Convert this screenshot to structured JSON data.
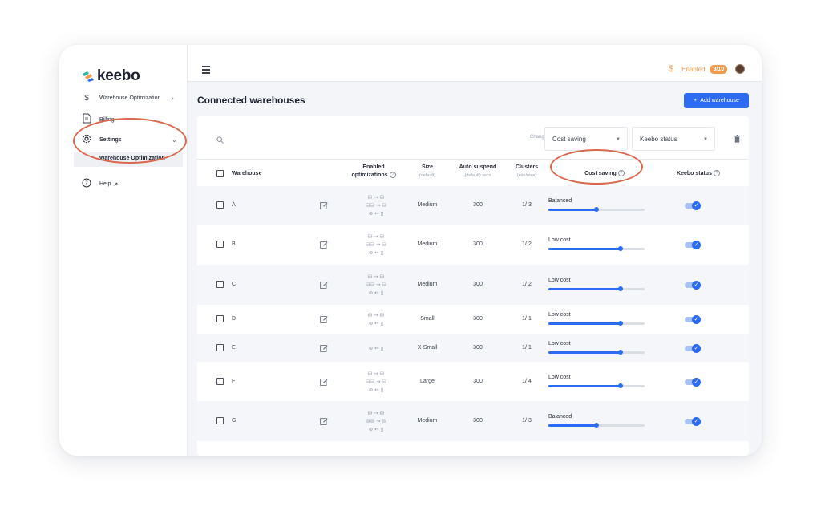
{
  "brand": {
    "name": "keebo"
  },
  "sidebar": {
    "items": [
      {
        "label": "Warehouse Optimization",
        "icon": "dollar-icon",
        "chevron": "›"
      },
      {
        "label": "Billing",
        "icon": "invoice-icon"
      },
      {
        "label": "Settings",
        "icon": "gear-icon",
        "chevron": "⌄"
      },
      {
        "label": "Warehouse Optimization",
        "sub": true
      },
      {
        "label": "Help",
        "icon": "help-icon"
      }
    ]
  },
  "topbar": {
    "enabled_label": "Enabled",
    "enabled_count": "9/10"
  },
  "page": {
    "title": "Connected warehouses",
    "add_button": "Add warehouse",
    "add_icon": "+"
  },
  "filters": {
    "change_label": "Change",
    "cost_saving": "Cost saving",
    "keebo_status": "Keebo status"
  },
  "table": {
    "headers": {
      "warehouse": "Warehouse",
      "enabled": "Enabled",
      "optimizations": "optimizations",
      "size": "Size",
      "size_sub": "(default)",
      "auto_suspend": "Auto suspend",
      "auto_suspend_sub": "(default) secs",
      "clusters": "Clusters",
      "clusters_sub": "(min/max)",
      "cost_saving": "Cost saving",
      "keebo_status": "Keebo status"
    },
    "rows": [
      {
        "name": "A",
        "size": "Medium",
        "auto_suspend": "300",
        "clusters": "1/ 3",
        "cost_label": "Balanced",
        "level": 0.5,
        "opts": [
          "⛁ → ⛁",
          "⛁⛁ → ⛁",
          "⊜ ↔ ▯"
        ],
        "status": true
      },
      {
        "name": "B",
        "size": "Medium",
        "auto_suspend": "300",
        "clusters": "1/ 2",
        "cost_label": "Low cost",
        "level": 0.75,
        "opts": [
          "⛁ → ⛁",
          "⛁⛁ → ⛁",
          "⊜ ↔ ▯"
        ],
        "status": true
      },
      {
        "name": "C",
        "size": "Medium",
        "auto_suspend": "300",
        "clusters": "1/ 2",
        "cost_label": "Low cost",
        "level": 0.75,
        "opts": [
          "⛁ → ⛁",
          "⛁⛁ → ⛁",
          "⊜ ↔ ▯"
        ],
        "status": true
      },
      {
        "name": "D",
        "size": "Small",
        "auto_suspend": "300",
        "clusters": "1/ 1",
        "cost_label": "Low cost",
        "level": 0.75,
        "opts": [
          "⛁ → ⛁",
          "⊜ ↔ ▯"
        ],
        "status": true
      },
      {
        "name": "E",
        "size": "X-Small",
        "auto_suspend": "300",
        "clusters": "1/ 1",
        "cost_label": "Low cost",
        "level": 0.75,
        "opts": [
          "⊜ ↔ ▯"
        ],
        "status": true
      },
      {
        "name": "F",
        "size": "Large",
        "auto_suspend": "300",
        "clusters": "1/ 4",
        "cost_label": "Low cost",
        "level": 0.75,
        "opts": [
          "⛁ → ⛁",
          "⛁⛁ → ⛁",
          "⊜ ↔ ▯"
        ],
        "status": true
      },
      {
        "name": "G",
        "size": "Medium",
        "auto_suspend": "300",
        "clusters": "1/ 3",
        "cost_label": "Balanced",
        "level": 0.5,
        "opts": [
          "⛁ → ⛁",
          "⛁⛁ → ⛁",
          "⊜ ↔ ▯"
        ],
        "status": true
      }
    ]
  },
  "colors": {
    "accent": "#2c6cf3",
    "annotation": "#d9684f",
    "badge": "#f2994a"
  }
}
